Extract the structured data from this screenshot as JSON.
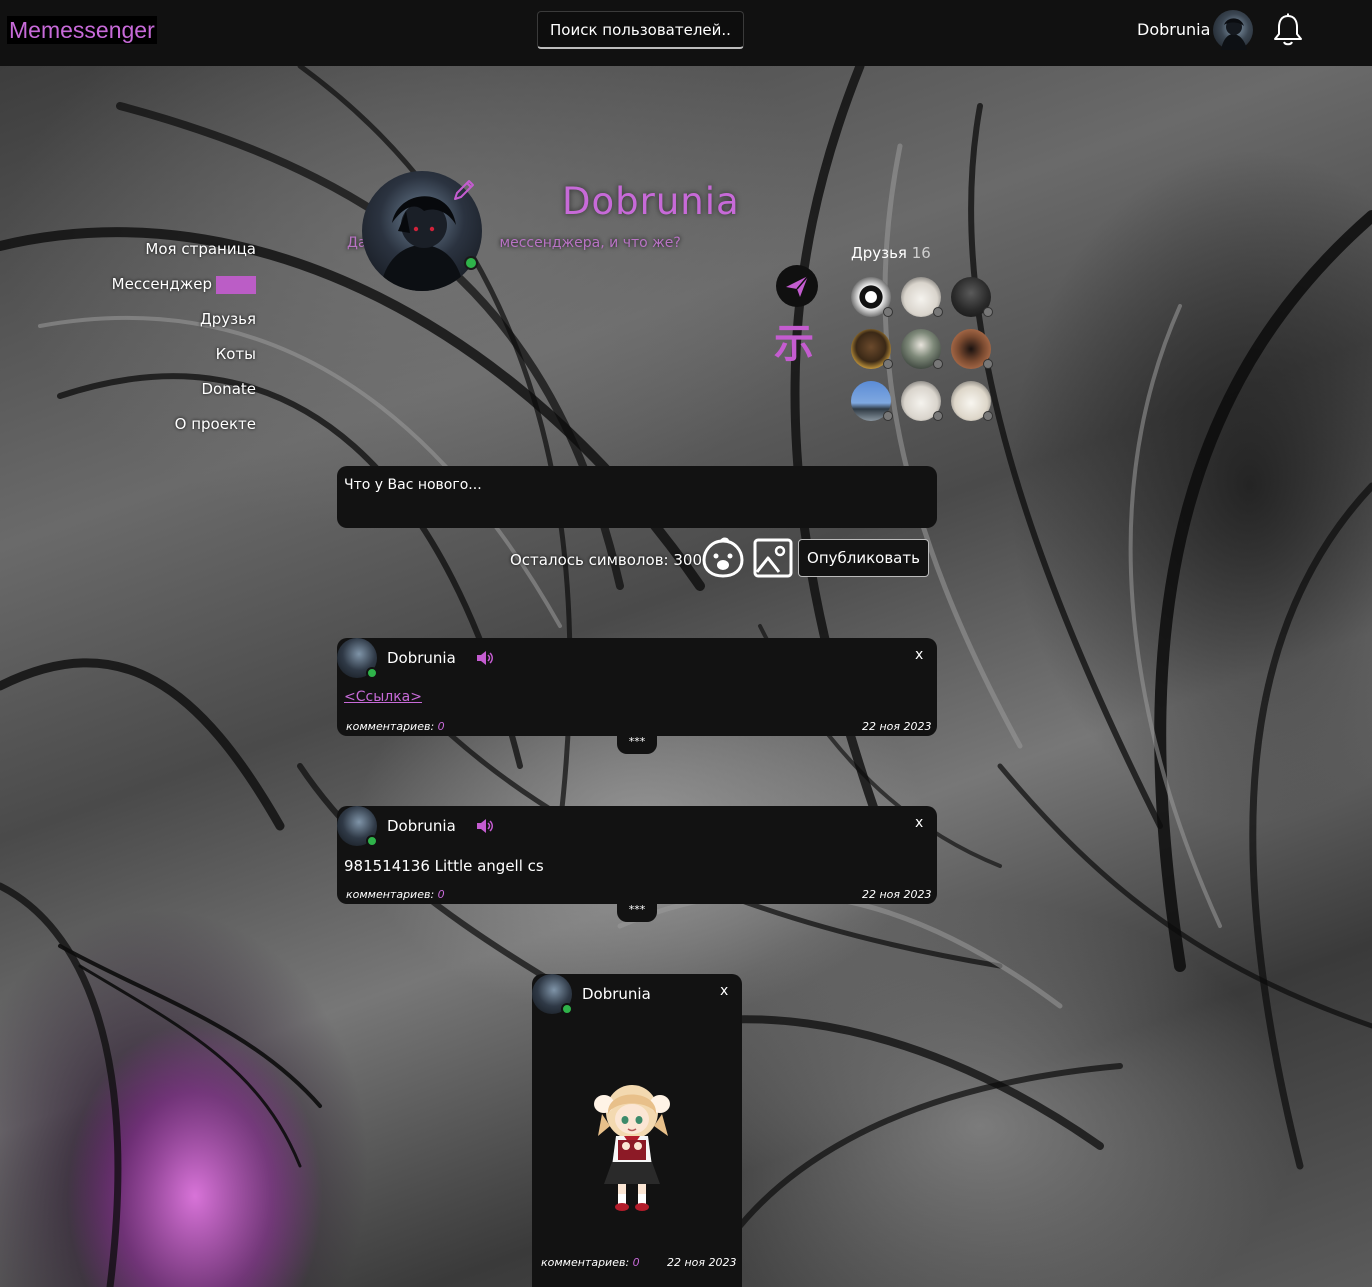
{
  "app": {
    "logo": "Memessenger",
    "search_placeholder": "Поиск пользователей..",
    "user_name": "Dobrunia"
  },
  "nav": {
    "items": [
      {
        "label": "Моя страница"
      },
      {
        "label": "Мессенджер"
      },
      {
        "label": "Друзья"
      },
      {
        "label": "Коты"
      },
      {
        "label": "Donate"
      },
      {
        "label": "О проекте"
      }
    ]
  },
  "profile": {
    "name": "Dobrunia",
    "status_visible": "Да",
    "status_tail": "мессенджера, и что же?",
    "glyph": "示"
  },
  "friends": {
    "label": "Друзья",
    "count": "16"
  },
  "composer": {
    "placeholder": "Что у Вас нового...",
    "chars_label": "Осталось символов: 300",
    "publish_label": "Опубликовать"
  },
  "posts": [
    {
      "author": "Dobrunia",
      "close": "x",
      "link": "<Ссылка>",
      "comments_label": "комментариев:",
      "comments_count": "0",
      "date": "22 ноя 2023",
      "more": "***"
    },
    {
      "author": "Dobrunia",
      "close": "x",
      "text": "981514136 Little angell cs",
      "comments_label": "комментариев:",
      "comments_count": "0",
      "date": "22 ноя 2023",
      "more": "***"
    },
    {
      "author": "Dobrunia",
      "close": "x",
      "comments_label": "комментариев:",
      "comments_count": "0",
      "date": "22 ноя 2023"
    }
  ],
  "colors": {
    "accent": "#c76ad8",
    "panel": "#121212",
    "online": "#2fb34a"
  }
}
